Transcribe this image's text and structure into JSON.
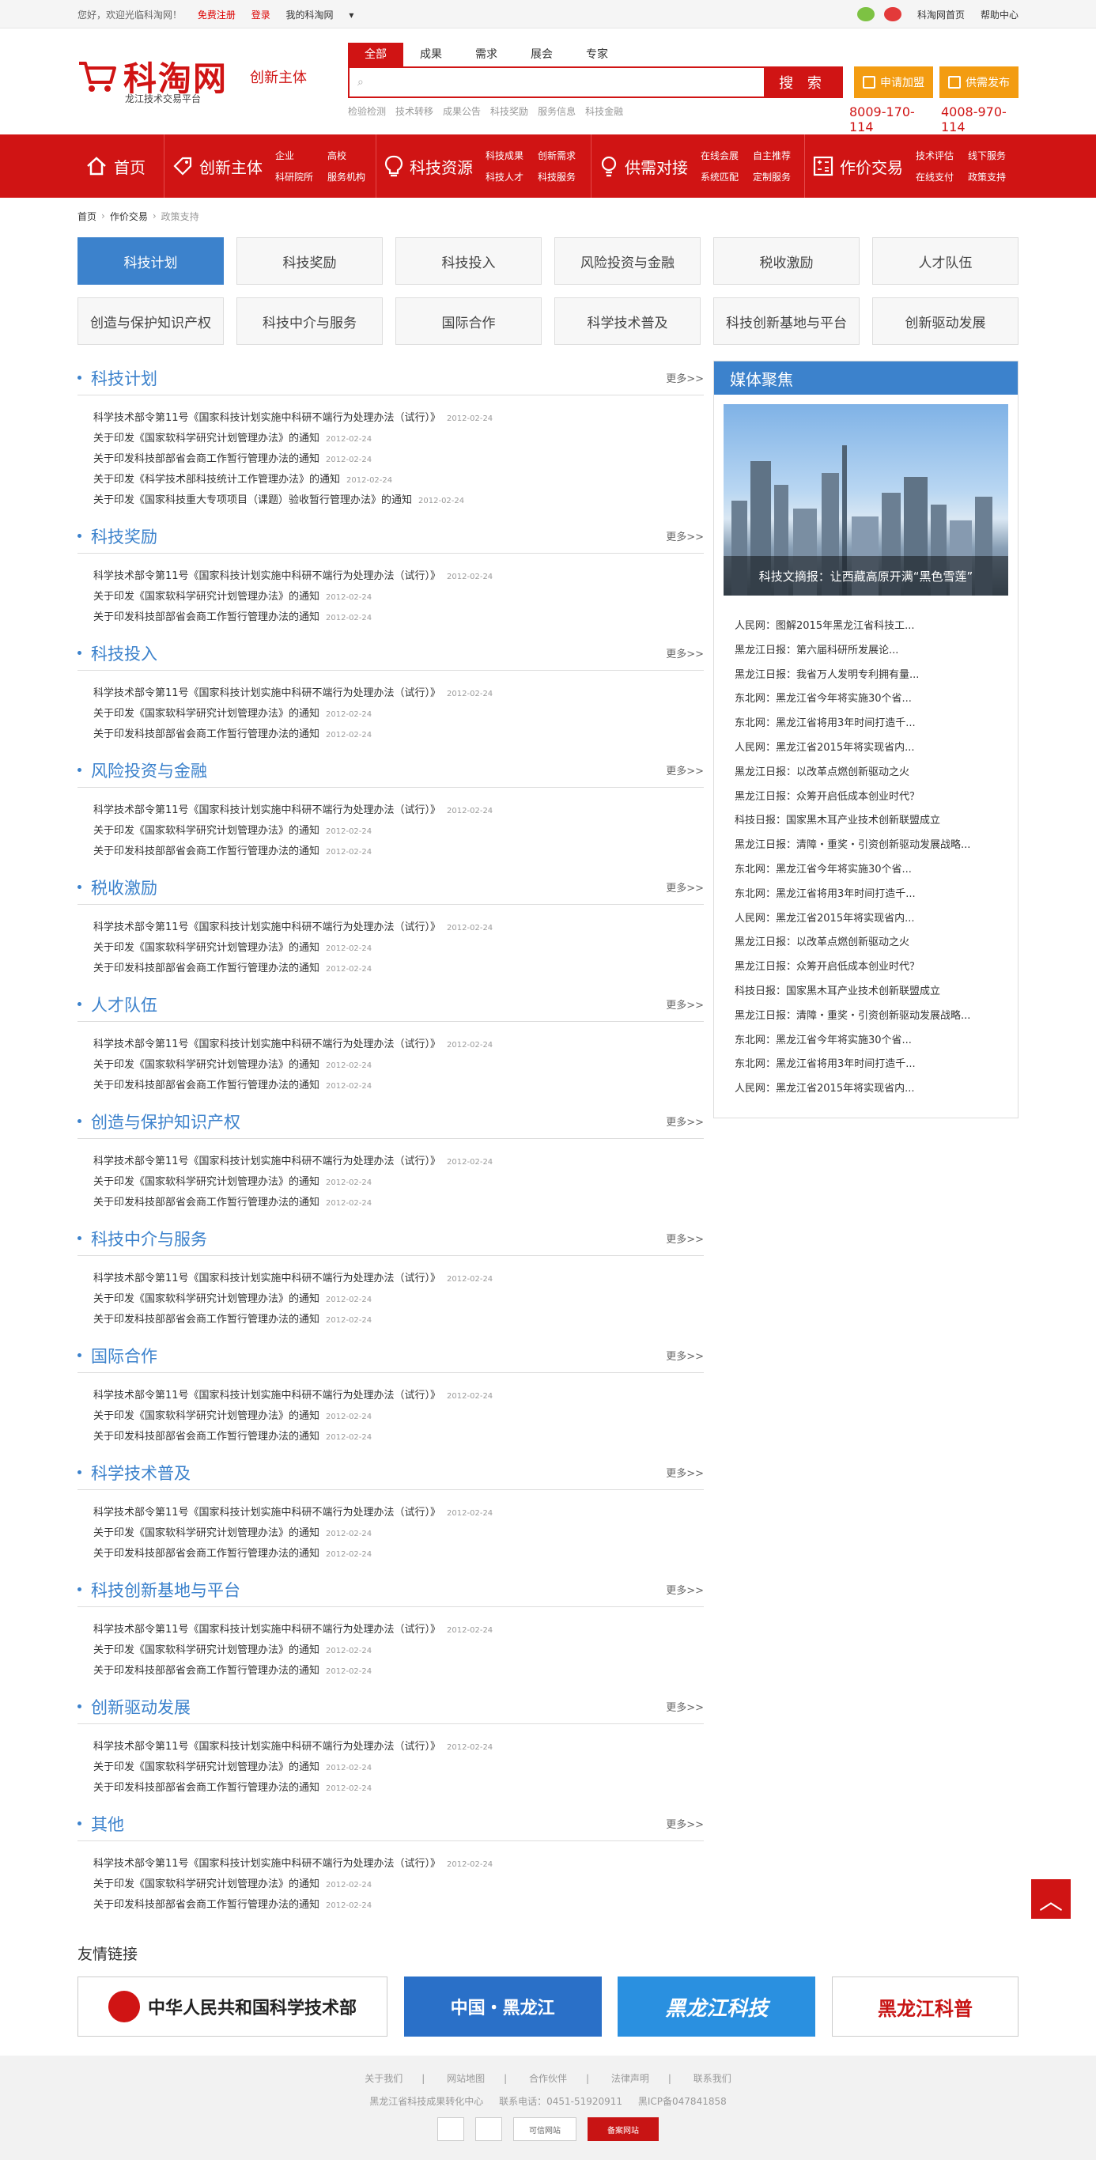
{
  "topbar": {
    "welcome": "您好，欢迎光临科淘网！",
    "register": "免费注册",
    "login": "登录",
    "my_account": "我的科淘网",
    "home_link": "科淘网首页",
    "help": "帮助中心"
  },
  "header": {
    "logo": "科淘网",
    "logo_sub": "龙江技术交易平台",
    "slogan": "创新主体",
    "search_tabs": [
      "全部",
      "成果",
      "需求",
      "展会",
      "专家"
    ],
    "search_button": "搜 索",
    "hot_keywords": [
      "检验检测",
      "技术转移",
      "成果公告",
      "科技奖励",
      "服务信息",
      "科技金融"
    ],
    "apply_join": "申请加盟",
    "publish_demand": "供需发布",
    "phone1": "8009-170-114",
    "phone2": "4008-970-114"
  },
  "nav": {
    "home": "首页",
    "sections": [
      {
        "label": "创新主体",
        "items": [
          "企业",
          "高校",
          "科研院所",
          "服务机构"
        ]
      },
      {
        "label": "科技资源",
        "items": [
          "科技成果",
          "创新需求",
          "科技人才",
          "科技服务"
        ]
      },
      {
        "label": "供需对接",
        "items": [
          "在线会展",
          "自主推荐",
          "系统匹配",
          "定制服务"
        ]
      },
      {
        "label": "作价交易",
        "items": [
          "技术评估",
          "线下服务",
          "在线支付",
          "政策支持"
        ]
      }
    ]
  },
  "breadcrumb": [
    "首页",
    "作价交易",
    "政策支持"
  ],
  "categories": [
    "科技计划",
    "科技奖励",
    "科技投入",
    "风险投资与金融",
    "税收激励",
    "人才队伍",
    "创造与保护知识产权",
    "科技中介与服务",
    "国际合作",
    "科学技术普及",
    "科技创新基地与平台",
    "创新驱动发展"
  ],
  "more_label": "更多>>",
  "sections": [
    {
      "title": "科技计划",
      "items": [
        {
          "text": "科学技术部令第11号《国家科技计划实施中科研不端行为处理办法（试行）》",
          "date": "2012-02-24"
        },
        {
          "text": "关于印发《国家软科学研究计划管理办法》的通知",
          "date": "2012-02-24"
        },
        {
          "text": "关于印发科技部部省会商工作暂行管理办法的通知",
          "date": "2012-02-24"
        },
        {
          "text": "关于印发《科学技术部科技统计工作管理办法》的通知",
          "date": "2012-02-24"
        },
        {
          "text": "关于印发《国家科技重大专项项目（课题）验收暂行管理办法》的通知",
          "date": "2012-02-24"
        }
      ]
    },
    {
      "title": "科技奖励",
      "items": [
        {
          "text": "科学技术部令第11号《国家科技计划实施中科研不端行为处理办法（试行）》",
          "date": "2012-02-24"
        },
        {
          "text": "关于印发《国家软科学研究计划管理办法》的通知",
          "date": "2012-02-24"
        },
        {
          "text": "关于印发科技部部省会商工作暂行管理办法的通知",
          "date": "2012-02-24"
        }
      ]
    },
    {
      "title": "科技投入",
      "items": [
        {
          "text": "科学技术部令第11号《国家科技计划实施中科研不端行为处理办法（试行）》",
          "date": "2012-02-24"
        },
        {
          "text": "关于印发《国家软科学研究计划管理办法》的通知",
          "date": "2012-02-24"
        },
        {
          "text": "关于印发科技部部省会商工作暂行管理办法的通知",
          "date": "2012-02-24"
        }
      ]
    },
    {
      "title": "风险投资与金融",
      "items": [
        {
          "text": "科学技术部令第11号《国家科技计划实施中科研不端行为处理办法（试行）》",
          "date": "2012-02-24"
        },
        {
          "text": "关于印发《国家软科学研究计划管理办法》的通知",
          "date": "2012-02-24"
        },
        {
          "text": "关于印发科技部部省会商工作暂行管理办法的通知",
          "date": "2012-02-24"
        }
      ]
    },
    {
      "title": "税收激励",
      "items": [
        {
          "text": "科学技术部令第11号《国家科技计划实施中科研不端行为处理办法（试行）》",
          "date": "2012-02-24"
        },
        {
          "text": "关于印发《国家软科学研究计划管理办法》的通知",
          "date": "2012-02-24"
        },
        {
          "text": "关于印发科技部部省会商工作暂行管理办法的通知",
          "date": "2012-02-24"
        }
      ]
    },
    {
      "title": "人才队伍",
      "items": [
        {
          "text": "科学技术部令第11号《国家科技计划实施中科研不端行为处理办法（试行）》",
          "date": "2012-02-24"
        },
        {
          "text": "关于印发《国家软科学研究计划管理办法》的通知",
          "date": "2012-02-24"
        },
        {
          "text": "关于印发科技部部省会商工作暂行管理办法的通知",
          "date": "2012-02-24"
        }
      ]
    },
    {
      "title": "创造与保护知识产权",
      "items": [
        {
          "text": "科学技术部令第11号《国家科技计划实施中科研不端行为处理办法（试行）》",
          "date": "2012-02-24"
        },
        {
          "text": "关于印发《国家软科学研究计划管理办法》的通知",
          "date": "2012-02-24"
        },
        {
          "text": "关于印发科技部部省会商工作暂行管理办法的通知",
          "date": "2012-02-24"
        }
      ]
    },
    {
      "title": "科技中介与服务",
      "items": [
        {
          "text": "科学技术部令第11号《国家科技计划实施中科研不端行为处理办法（试行）》",
          "date": "2012-02-24"
        },
        {
          "text": "关于印发《国家软科学研究计划管理办法》的通知",
          "date": "2012-02-24"
        },
        {
          "text": "关于印发科技部部省会商工作暂行管理办法的通知",
          "date": "2012-02-24"
        }
      ]
    },
    {
      "title": "国际合作",
      "items": [
        {
          "text": "科学技术部令第11号《国家科技计划实施中科研不端行为处理办法（试行）》",
          "date": "2012-02-24"
        },
        {
          "text": "关于印发《国家软科学研究计划管理办法》的通知",
          "date": "2012-02-24"
        },
        {
          "text": "关于印发科技部部省会商工作暂行管理办法的通知",
          "date": "2012-02-24"
        }
      ]
    },
    {
      "title": "科学技术普及",
      "items": [
        {
          "text": "科学技术部令第11号《国家科技计划实施中科研不端行为处理办法（试行）》",
          "date": "2012-02-24"
        },
        {
          "text": "关于印发《国家软科学研究计划管理办法》的通知",
          "date": "2012-02-24"
        },
        {
          "text": "关于印发科技部部省会商工作暂行管理办法的通知",
          "date": "2012-02-24"
        }
      ]
    },
    {
      "title": "科技创新基地与平台",
      "items": [
        {
          "text": "科学技术部令第11号《国家科技计划实施中科研不端行为处理办法（试行）》",
          "date": "2012-02-24"
        },
        {
          "text": "关于印发《国家软科学研究计划管理办法》的通知",
          "date": "2012-02-24"
        },
        {
          "text": "关于印发科技部部省会商工作暂行管理办法的通知",
          "date": "2012-02-24"
        }
      ]
    },
    {
      "title": "创新驱动发展",
      "items": [
        {
          "text": "科学技术部令第11号《国家科技计划实施中科研不端行为处理办法（试行）》",
          "date": "2012-02-24"
        },
        {
          "text": "关于印发《国家软科学研究计划管理办法》的通知",
          "date": "2012-02-24"
        },
        {
          "text": "关于印发科技部部省会商工作暂行管理办法的通知",
          "date": "2012-02-24"
        }
      ]
    },
    {
      "title": "其他",
      "items": [
        {
          "text": "科学技术部令第11号《国家科技计划实施中科研不端行为处理办法（试行）》",
          "date": "2012-02-24"
        },
        {
          "text": "关于印发《国家软科学研究计划管理办法》的通知",
          "date": "2012-02-24"
        },
        {
          "text": "关于印发科技部部省会商工作暂行管理办法的通知",
          "date": "2012-02-24"
        }
      ]
    }
  ],
  "media": {
    "title": "媒体聚焦",
    "caption": "科技文摘报：让西藏高原开满“黑色雪莲”",
    "items": [
      "人民网：图解2015年黑龙江省科技工...",
      "黑龙江日报：第六届科研所发展论...",
      "黑龙江日报：我省万人发明专利拥有量...",
      "东北网：黑龙江省今年将实施30个省...",
      "东北网：黑龙江省将用3年时间打造千...",
      "人民网：黑龙江省2015年将实现省内...",
      "黑龙江日报：以改革点燃创新驱动之火",
      "黑龙江日报：众筹开启低成本创业时代？",
      "科技日报：国家黑木耳产业技术创新联盟成立",
      "黑龙江日报：清障・重奖・引资创新驱动发展战略...",
      "东北网：黑龙江省今年将实施30个省...",
      "东北网：黑龙江省将用3年时间打造千...",
      "人民网：黑龙江省2015年将实现省内...",
      "黑龙江日报：以改革点燃创新驱动之火",
      "黑龙江日报：众筹开启低成本创业时代？",
      "科技日报：国家黑木耳产业技术创新联盟成立",
      "黑龙江日报：清障・重奖・引资创新驱动发展战略...",
      "东北网：黑龙江省今年将实施30个省...",
      "东北网：黑龙江省将用3年时间打造千...",
      "人民网：黑龙江省2015年将实现省内..."
    ]
  },
  "friends": {
    "title": "友情链接",
    "links": [
      "中华人民共和国科学技术部",
      "中国・黑龙江",
      "黑龙江科技",
      "黑龙江科普"
    ]
  },
  "footer": {
    "links": [
      "关于我们",
      "网站地图",
      "合作伙伴",
      "法律声明",
      "联系我们"
    ],
    "org": "黑龙江省科技成果转化中心",
    "phone": "联系电话：0451-51920911",
    "icp": "黑ICP备047841858",
    "badges": [
      "",
      "",
      "可信网站",
      "备案网站"
    ]
  }
}
